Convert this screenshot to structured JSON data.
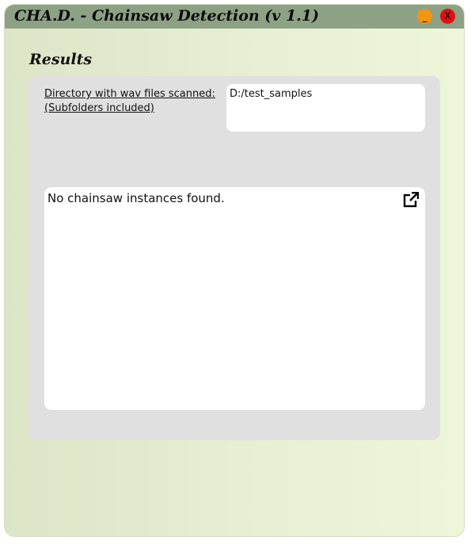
{
  "window": {
    "title": "CHA.D. - Chainsaw Detection (v 1.1)",
    "minimize_label": "_",
    "close_label": "X"
  },
  "results": {
    "heading": "Results",
    "directory_label_line1": "Directory with wav files scanned:",
    "directory_label_line2": "(Subfolders included)",
    "directory_value": "D:/test_samples",
    "output_text": "No chainsaw instances found."
  },
  "icons": {
    "export": "external-link-icon"
  },
  "colors": {
    "titlebar": "#8da184",
    "minimize_button": "#f5940f",
    "close_button": "#e01010",
    "panel": "#e0e0e0"
  }
}
